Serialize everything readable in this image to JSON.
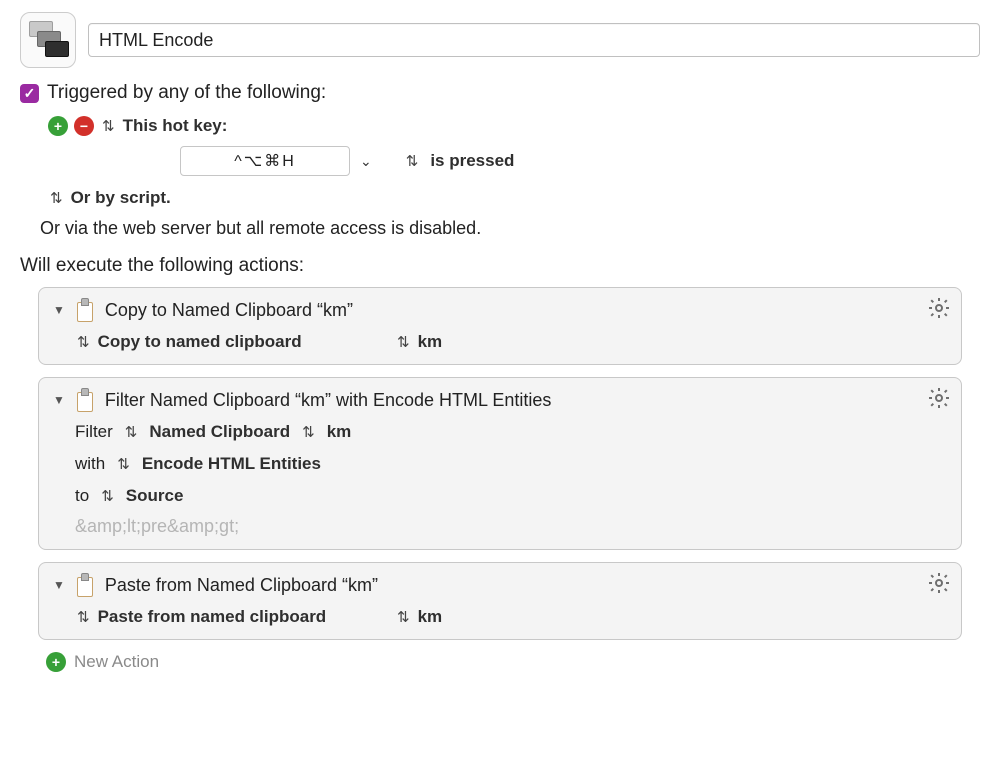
{
  "macro": {
    "name": "HTML Encode"
  },
  "triggers": {
    "header_label": "Triggered by any of the following:",
    "hotkey_label": "This hot key:",
    "hotkey_combo": "^⌥⌘H",
    "pressed_label": "is pressed",
    "script_label": "Or by script.",
    "webserver_label": "Or via the web server but all remote access is disabled."
  },
  "actions_header": "Will execute the following actions:",
  "actions": {
    "copy": {
      "title": "Copy to Named Clipboard “km”",
      "mode_label": "Copy to named clipboard",
      "target_label": "km"
    },
    "filter": {
      "title": "Filter Named Clipboard “km” with Encode HTML Entities",
      "filter_label": "Filter",
      "source_type": "Named Clipboard",
      "source_name": "km",
      "with_label": "with",
      "filter_type": "Encode HTML Entities",
      "to_label": "to",
      "to_target": "Source",
      "placeholder": "&amp;lt;pre&amp;gt;"
    },
    "paste": {
      "title": "Paste from Named Clipboard “km”",
      "mode_label": "Paste from named clipboard",
      "target_label": "km"
    }
  },
  "new_action_label": "New Action"
}
